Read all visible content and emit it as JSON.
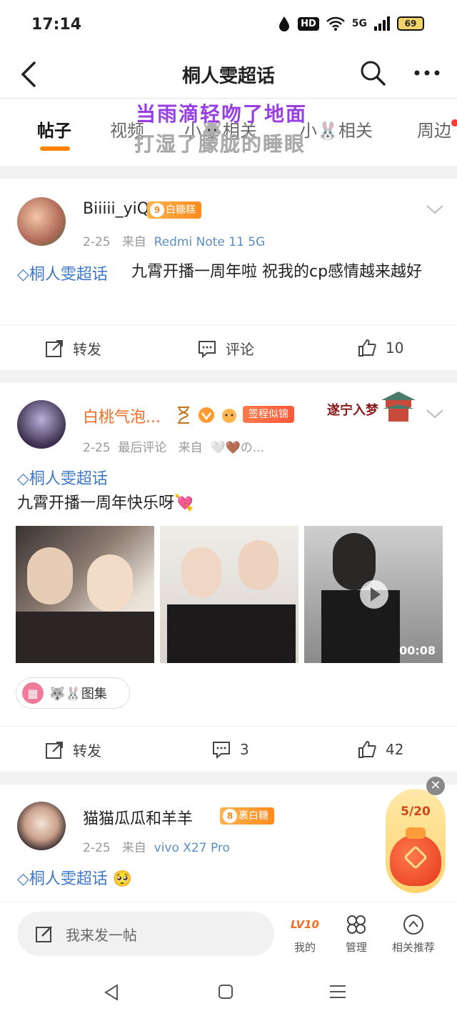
{
  "status": {
    "time": "17:14",
    "hd": "HD",
    "network": "5G",
    "battery": "69"
  },
  "nav": {
    "title": "桐人雯超话"
  },
  "tabs": [
    {
      "label": "帖子"
    },
    {
      "label": "视频"
    },
    {
      "label": "小🐺相关"
    },
    {
      "label": "小🐰相关"
    },
    {
      "label": "周边"
    }
  ],
  "overlay": {
    "line1": "当雨滴轻吻了地面",
    "line2": "打湿了朦胧的睡眼"
  },
  "posts": [
    {
      "user": "Biiiii_yiQ",
      "badge_level": "9",
      "badge": "白糖糕",
      "date": "2-25",
      "from": "来自",
      "device": "Redmi Note 11 5G",
      "topic": "桐人雯超话",
      "text": "九霄开播一周年啦 祝我的cp感情越来越好",
      "repost": "转发",
      "comment": "评论",
      "likes": "10"
    },
    {
      "user": "白桃气泡...",
      "badge": "签程似锦",
      "decor": "遂宁入梦",
      "date": "2-25",
      "last_comment": "最后评论",
      "from": "来自",
      "device": "🤍🤎の...",
      "topic": "桐人雯超话",
      "text": "九霄开播一周年快乐呀💘",
      "video_duration": "00:08",
      "album": "🐺🐰图集",
      "repost": "转发",
      "comments": "3",
      "likes": "42"
    },
    {
      "user": "猫猫瓜瓜和羊羊",
      "badge_level": "8",
      "badge": "裹白糖",
      "date": "2-25",
      "from": "来自",
      "device": "vivo X27 Pro",
      "topic": "桐人雯超话 🥺"
    }
  ],
  "packet": {
    "count": "5/20"
  },
  "bottom": {
    "compose_placeholder": "我来发一帖",
    "mine_level": "LV10",
    "mine": "我的",
    "manage": "管理",
    "related": "相关推荐"
  },
  "colors": {
    "accent": "#ff8200",
    "topic": "#3e78c9",
    "orange_name": "#f36c21"
  }
}
